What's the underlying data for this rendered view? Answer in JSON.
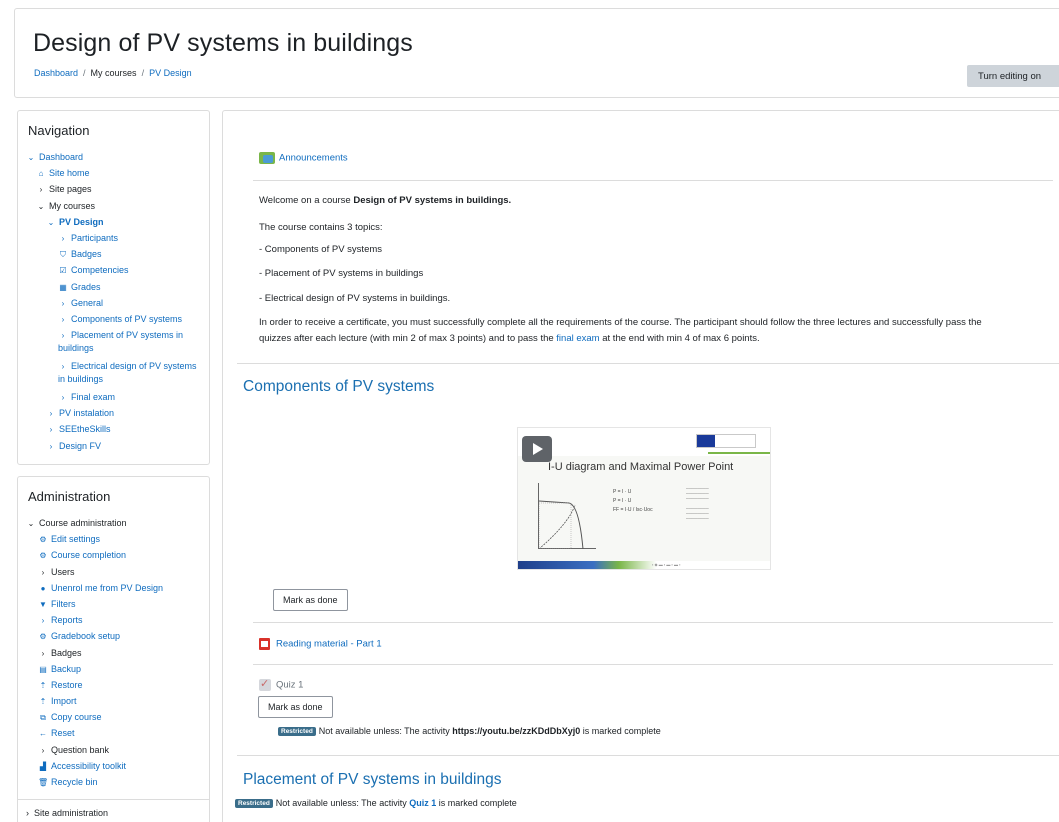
{
  "header": {
    "title": "Design of PV systems in buildings",
    "breadcrumb": [
      "Dashboard",
      "My courses",
      "PV Design"
    ],
    "edit_button": "Turn editing on"
  },
  "navigation": {
    "title": "Navigation",
    "items": [
      {
        "label": "Dashboard"
      },
      {
        "label": "Site home"
      },
      {
        "label": "Site pages"
      },
      {
        "label": "My courses"
      },
      {
        "label": "PV Design"
      },
      {
        "label": "Participants"
      },
      {
        "label": "Badges"
      },
      {
        "label": "Competencies"
      },
      {
        "label": "Grades"
      },
      {
        "label": "General"
      },
      {
        "label": "Components of PV systems"
      },
      {
        "label": "Placement of PV systems in buildings"
      },
      {
        "label": "Electrical design of PV systems in buildings"
      },
      {
        "label": "Final exam"
      },
      {
        "label": "PV instalation"
      },
      {
        "label": "SEEtheSkills"
      },
      {
        "label": "Design FV"
      }
    ]
  },
  "administration": {
    "title": "Administration",
    "items": [
      {
        "label": "Course administration"
      },
      {
        "label": "Edit settings"
      },
      {
        "label": "Course completion"
      },
      {
        "label": "Users"
      },
      {
        "label": "Unenrol me from PV Design"
      },
      {
        "label": "Filters"
      },
      {
        "label": "Reports"
      },
      {
        "label": "Gradebook setup"
      },
      {
        "label": "Badges"
      },
      {
        "label": "Backup"
      },
      {
        "label": "Restore"
      },
      {
        "label": "Import"
      },
      {
        "label": "Copy course"
      },
      {
        "label": "Reset"
      },
      {
        "label": "Question bank"
      },
      {
        "label": "Accessibility toolkit"
      },
      {
        "label": "Recycle bin"
      }
    ],
    "site_admin": "Site administration"
  },
  "main": {
    "announcements": "Announcements",
    "summary": {
      "welcome_prefix": "Welcome on a course ",
      "welcome_bold": "Design of PV systems in buildings.",
      "topics_intro": "The course contains 3 topics:",
      "topic1": "- Components of PV systems",
      "topic2": "- Placement of PV systems in buildings",
      "topic3": "- Electrical design of PV systems in buildings.",
      "req_line1": "In order to receive a certificate, you must successfully complete all the requirements of the course. The participant should follow the three lectures and successfully pass the",
      "req_line2_prefix": "quizzes after each lecture (with min 2 of max 3 points) and to pass the ",
      "req_line2_link": "final exam",
      "req_line2_suffix": " at the end with min 4 of max 6 points."
    },
    "section1": {
      "title": "Components of PV systems",
      "video_title": "I-U diagram and Maximal Power Point",
      "mark_done": "Mark as done",
      "reading": "Reading material - Part 1",
      "quiz": "Quiz 1",
      "quiz_mark_done": "Mark as done",
      "restricted_badge": "Restricted",
      "restriction_prefix": "Not available unless: The activity ",
      "restriction_bold": "https://youtu.be/zzKDdDbXyj0",
      "restriction_suffix": " is marked complete"
    },
    "section2": {
      "title": "Placement of PV systems in buildings",
      "restricted_badge": "Restricted",
      "restriction_prefix": "Not available unless: The activity ",
      "restriction_link": "Quiz 1",
      "restriction_suffix": " is marked complete"
    }
  },
  "colors": {
    "link": "#0f6cbf",
    "section_title": "#1a6fb1",
    "edit_button_bg": "#ced4da",
    "restricted_badge": "#3a6d8a"
  }
}
